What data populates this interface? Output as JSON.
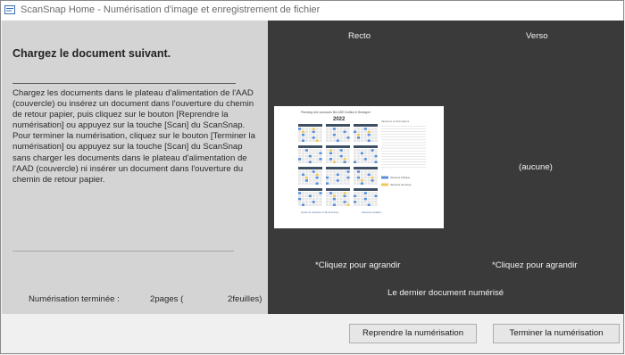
{
  "window": {
    "title": "ScanSnap Home - Numérisation d'image et enregistrement de fichier",
    "icon": "scanner-app-icon"
  },
  "left_panel": {
    "heading": "Chargez le document suivant.",
    "instructions": "Chargez les documents dans le plateau d'alimentation de l'AAD (couvercle) ou insérez un document dans l'ouverture du chemin de retour papier, puis cliquez sur le bouton [Reprendre la numérisation] ou appuyez sur la touche [Scan] du ScanSnap. Pour terminer la numérisation, cliquez sur le bouton [Terminer la numérisation] ou appuyez sur la touche [Scan] du ScanSnap sans charger les documents dans le plateau d'alimentation de l'AAD (couvercle) ni insérer un document dans l'ouverture du chemin de retour papier.",
    "status_label": "Numérisation terminée :",
    "pages": "2pages (",
    "sheets": "2feuilles)"
  },
  "preview": {
    "front_label": "Recto",
    "back_label": "Verso",
    "back_empty": "(aucune)",
    "front_enlarge": "*Cliquez pour agrandir",
    "back_enlarge": "*Cliquez pour agrandir",
    "caption": "Le dernier document numérisé",
    "thumbnail": {
      "doc_title": "Planning des vacances BA-ADE Institut et Bretagne",
      "year": "2022",
      "footer_left": "Année de vacances en Île de France",
      "footer_right": "Vacances scolaires",
      "legend_heading": "Vacances et informations",
      "legend_blue": "Vacances d'Afrique",
      "legend_yellow": "Vacances de bureau",
      "accent_blue": "#5b8fd6",
      "accent_yellow": "#f0c85a",
      "header_dark": "#3f4f63"
    }
  },
  "buttons": {
    "resume": "Reprendre la numérisation",
    "finish": "Terminer la numérisation"
  }
}
